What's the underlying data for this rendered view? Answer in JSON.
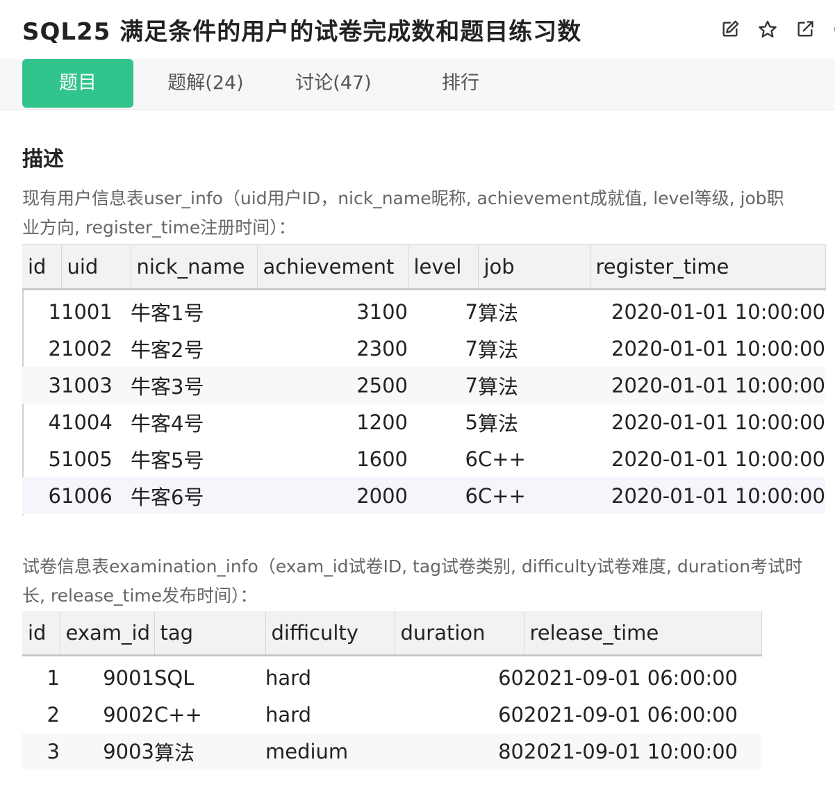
{
  "header": {
    "title": "SQL25  满足条件的用户的试卷完成数和题目练习数"
  },
  "toolbar": {
    "icons": [
      "edit-icon",
      "star-icon",
      "share-icon",
      "more-icon"
    ]
  },
  "tabs": [
    {
      "label": "题目",
      "active": true
    },
    {
      "label": "题解(24)",
      "active": false
    },
    {
      "label": "讨论(47)",
      "active": false
    },
    {
      "label": "排行",
      "active": false
    }
  ],
  "description": {
    "heading": "描述",
    "para1_line1": "现有用户信息表user_info（uid用户ID，nick_name昵称, achievement成就值, level等级, job职",
    "para1_line2": "业方向, register_time注册时间）：",
    "para2_line1": "试卷信息表examination_info（exam_id试卷ID, tag试卷类别, difficulty试卷难度, duration考试时",
    "para2_line2": "长, release_time发布时间）："
  },
  "user_table": {
    "columns": [
      "id",
      "uid",
      "nick_name",
      "achievement",
      "level",
      "job",
      "register_time"
    ],
    "rows": [
      [
        "1",
        "1001",
        "牛客1号",
        "3100",
        "7",
        "算法",
        "2020-01-01 10:00:00"
      ],
      [
        "2",
        "1002",
        "牛客2号",
        "2300",
        "7",
        "算法",
        "2020-01-01 10:00:00"
      ],
      [
        "3",
        "1003",
        "牛客3号",
        "2500",
        "7",
        "算法",
        "2020-01-01 10:00:00"
      ],
      [
        "4",
        "1004",
        "牛客4号",
        "1200",
        "5",
        "算法",
        "2020-01-01 10:00:00"
      ],
      [
        "5",
        "1005",
        "牛客5号",
        "1600",
        "6",
        "C++",
        "2020-01-01 10:00:00"
      ],
      [
        "6",
        "1006",
        "牛客6号",
        "2000",
        "6",
        "C++",
        "2020-01-01 10:00:00"
      ]
    ]
  },
  "exam_table": {
    "columns": [
      "id",
      "exam_id",
      "tag",
      "difficulty",
      "duration",
      "release_time"
    ],
    "rows": [
      [
        "1",
        "9001",
        "SQL",
        "hard",
        "60",
        "2021-09-01 06:00:00"
      ],
      [
        "2",
        "9002",
        "C++",
        "hard",
        "60",
        "2021-09-01 06:00:00"
      ],
      [
        "3",
        "9003",
        "算法",
        "medium",
        "80",
        "2021-09-01 10:00:00"
      ]
    ]
  }
}
